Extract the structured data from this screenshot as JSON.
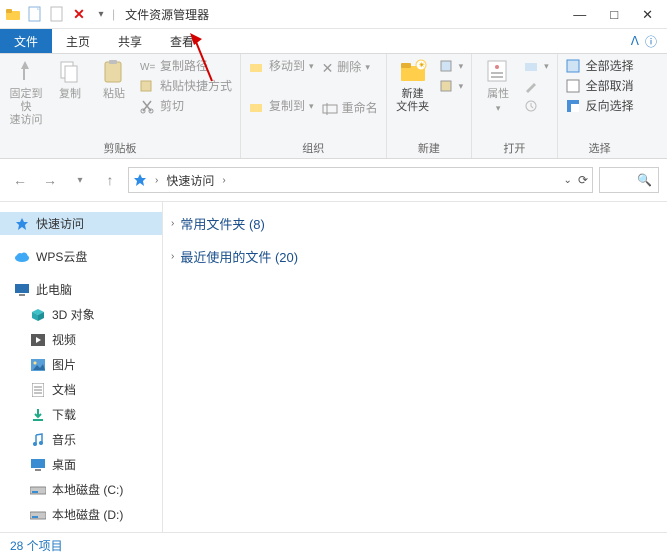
{
  "title": "文件资源管理器",
  "window_controls": {
    "min": "—",
    "max": "□",
    "close": "✕"
  },
  "qa_icons": [
    "folder",
    "new-doc",
    "doc",
    "close-x",
    "dropdown"
  ],
  "tabs": {
    "file": "文件",
    "home": "主页",
    "share": "共享",
    "view": "查看"
  },
  "ribbon": {
    "clipboard": {
      "pin": "固定到快\n速访问",
      "copy": "复制",
      "paste": "粘贴",
      "copy_path": "复制路径",
      "paste_shortcut": "粘贴快捷方式",
      "cut": "剪切",
      "label": "剪贴板"
    },
    "organize": {
      "move": "移动到",
      "copy_to": "复制到",
      "delete": "删除",
      "rename": "重命名",
      "label": "组织"
    },
    "new": {
      "folder": "新建\n文件夹",
      "label": "新建"
    },
    "open": {
      "props": "属性",
      "label": "打开"
    },
    "select": {
      "all": "全部选择",
      "none": "全部取消",
      "invert": "反向选择",
      "label": "选择"
    }
  },
  "breadcrumb": {
    "root": "快速访问"
  },
  "sidebar": {
    "items": [
      {
        "label": "快速访问",
        "icon": "star",
        "selected": true
      },
      {
        "label": "WPS云盘",
        "icon": "cloud",
        "child": false
      },
      {
        "label": "此电脑",
        "icon": "pc",
        "child": false
      },
      {
        "label": "3D 对象",
        "icon": "cube",
        "child": true
      },
      {
        "label": "视频",
        "icon": "video",
        "child": true
      },
      {
        "label": "图片",
        "icon": "picture",
        "child": true
      },
      {
        "label": "文档",
        "icon": "doc",
        "child": true
      },
      {
        "label": "下载",
        "icon": "download",
        "child": true
      },
      {
        "label": "音乐",
        "icon": "music",
        "child": true
      },
      {
        "label": "桌面",
        "icon": "desktop",
        "child": true
      },
      {
        "label": "本地磁盘 (C:)",
        "icon": "drive",
        "child": true
      },
      {
        "label": "本地磁盘 (D:)",
        "icon": "drive",
        "child": true
      }
    ]
  },
  "content": {
    "groups": [
      {
        "label": "常用文件夹 (8)"
      },
      {
        "label": "最近使用的文件 (20)"
      }
    ]
  },
  "status": "28 个项目"
}
